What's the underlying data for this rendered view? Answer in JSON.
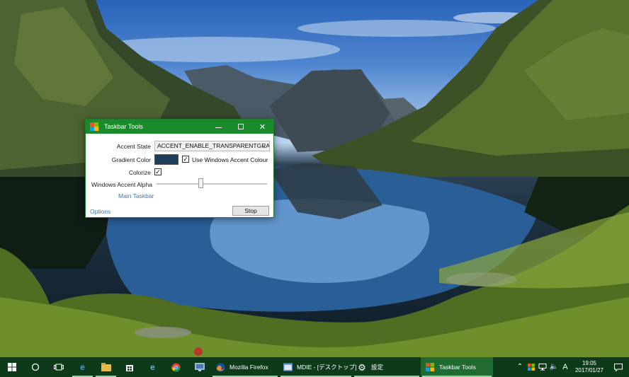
{
  "window": {
    "title": "Taskbar Tools",
    "accent_state_label": "Accent State",
    "accent_state_value": "ACCENT_ENABLE_TRANSPARENTGRAD",
    "gradient_color_label": "Gradient Color",
    "gradient_color": "#1f3e5c",
    "use_windows_accent_label": "Use Windows Accent Colour",
    "use_windows_accent_checked": true,
    "colorize_label": "Colorize",
    "colorize_checked": true,
    "windows_accent_alpha_label": "Windows Accent Alpha",
    "main_taskbar_link": "Main Taskbar",
    "options_link": "Options",
    "stop_button": "Stop"
  },
  "taskbar": {
    "pinned_icons": [
      "start-icon",
      "cortana-icon",
      "task-view-icon",
      "edge-icon",
      "file-explorer-icon",
      "store-icon",
      "ie-icon",
      "chrome-icon",
      "remote-app-icon"
    ],
    "apps": [
      {
        "icon": "firefox-icon",
        "label": "Mozilla Firefox"
      },
      {
        "icon": "mdie-icon",
        "label": "MDIE - [デスクトップ]"
      },
      {
        "icon": "settings-gear-icon",
        "label": "設定"
      },
      {
        "icon": "taskbar-tools-icon",
        "label": "Taskbar Tools"
      }
    ],
    "tray": {
      "ime_indicator": "A",
      "time": "19:05",
      "date": "2017/01/27"
    }
  },
  "colors": {
    "titlebar": "#1b8a2a",
    "taskbar": "#0d3b1a",
    "link": "#3a78b8"
  }
}
